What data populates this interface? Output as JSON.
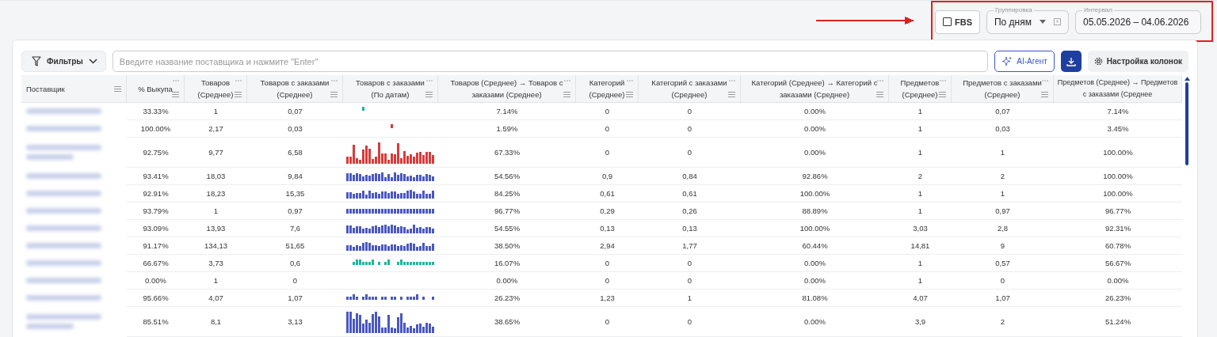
{
  "header": {
    "fbs": {
      "label": "FBS",
      "checked": false
    },
    "grouping": {
      "legend": "Группировка",
      "value": "По дням"
    },
    "interval": {
      "legend": "Интервал",
      "value": "05.05.2026 – 04.06.2026"
    }
  },
  "annotation": {
    "kind": "arrow-box",
    "color": "#e02020"
  },
  "toolbar": {
    "filters": "Фильтры",
    "search": {
      "placeholder": "Введите название поставщика и нажмите \"Enter\""
    },
    "ai": "AI-Агент",
    "settings": "Настройка колонок"
  },
  "table": {
    "columns": [
      {
        "label": "Поставщик",
        "kind": "name"
      },
      {
        "label": "% Выкупа",
        "kind": "num"
      },
      {
        "label": "Товаров (Среднее)",
        "kind": "num"
      },
      {
        "label": "Товаров с заказами (Среднее)",
        "kind": "num"
      },
      {
        "label": "Товаров с заказами (По датам)",
        "kind": "spark"
      },
      {
        "label": "Товаров (Среднее) → Товаров с заказами (Среднее)",
        "kind": "num"
      },
      {
        "label": "Категорий (Среднее)",
        "kind": "num"
      },
      {
        "label": "Категорий с заказами (Среднее)",
        "kind": "num"
      },
      {
        "label": "Категорий (Среднее) → Категорий с заказами (Среднее)",
        "kind": "num"
      },
      {
        "label": "Предметов (Среднее)",
        "kind": "num"
      },
      {
        "label": "Предметов с заказами (Среднее)",
        "kind": "num"
      },
      {
        "label": "Предметов (Среднее) → Предметов с заказами (Среднее",
        "kind": "num"
      }
    ],
    "rows": [
      {
        "kind": "single",
        "sparkline": {
          "kind": "single",
          "color": "#1fb59f"
        },
        "cells": [
          "",
          "33.33%",
          "1",
          "0,07",
          "",
          "7.14%",
          "0",
          "0",
          "0.00%",
          "1",
          "0,07",
          "7.14%"
        ]
      },
      {
        "kind": "single",
        "sparkline": {
          "kind": "single",
          "color": "#d93a3a"
        },
        "cells": [
          "",
          "100.00%",
          "2,17",
          "0,03",
          "",
          "1.59%",
          "0",
          "0",
          "0.00%",
          "1",
          "0,03",
          "3.45%"
        ]
      },
      {
        "kind": "double",
        "sparkline": {
          "kind": "tall",
          "color": "#d93a3a"
        },
        "cells": [
          "",
          "92.75%",
          "9,77",
          "6,58",
          "",
          "67.33%",
          "0",
          "0",
          "0.00%",
          "1",
          "1",
          "100.00%"
        ]
      },
      {
        "kind": "single",
        "sparkline": {
          "kind": "flat",
          "color": "#4a58c0"
        },
        "cells": [
          "",
          "93.41%",
          "18,03",
          "9,84",
          "",
          "54.56%",
          "0,9",
          "0,84",
          "92.86%",
          "2",
          "2",
          "100.00%"
        ]
      },
      {
        "kind": "single",
        "sparkline": {
          "kind": "flat",
          "color": "#4a58c0"
        },
        "cells": [
          "",
          "92.91%",
          "18,23",
          "15,35",
          "",
          "84.25%",
          "0,61",
          "0,61",
          "100.00%",
          "1",
          "1",
          "100.00%"
        ]
      },
      {
        "kind": "single",
        "sparkline": {
          "kind": "even",
          "color": "#4a58c0"
        },
        "cells": [
          "",
          "93.79%",
          "1",
          "0,97",
          "",
          "96.77%",
          "0,29",
          "0,26",
          "88.89%",
          "1",
          "0,97",
          "96.77%"
        ]
      },
      {
        "kind": "single",
        "sparkline": {
          "kind": "flat",
          "color": "#4a58c0"
        },
        "cells": [
          "",
          "93.09%",
          "13,93",
          "7,6",
          "",
          "54.55%",
          "0,13",
          "0,13",
          "100.00%",
          "3,03",
          "2,8",
          "92.31%"
        ]
      },
      {
        "kind": "single",
        "sparkline": {
          "kind": "flat",
          "color": "#4a58c0"
        },
        "cells": [
          "",
          "91.17%",
          "134,13",
          "51,65",
          "",
          "38.50%",
          "2,94",
          "1,77",
          "60.44%",
          "14,81",
          "9",
          "60.78%"
        ]
      },
      {
        "kind": "single",
        "sparkline": {
          "kind": "dots",
          "color": "#1fb59f"
        },
        "cells": [
          "",
          "66.67%",
          "3,73",
          "0,6",
          "",
          "16.07%",
          "0",
          "0",
          "0.00%",
          "1",
          "0,57",
          "56.67%"
        ]
      },
      {
        "kind": "single",
        "cells": [
          "",
          "0.00%",
          "1",
          "0",
          "",
          "0.00%",
          "0",
          "0",
          "0.00%",
          "1",
          "0",
          "0.00%"
        ]
      },
      {
        "kind": "single",
        "sparkline": {
          "kind": "dots",
          "color": "#4a58c0"
        },
        "cells": [
          "",
          "95.66%",
          "4,07",
          "1,07",
          "",
          "26.23%",
          "1,23",
          "1",
          "81.08%",
          "4,07",
          "1,07",
          "26.23%"
        ]
      },
      {
        "kind": "double",
        "sparkline": {
          "kind": "tall",
          "color": "#4a58c0"
        },
        "cells": [
          "",
          "85.51%",
          "8,1",
          "3,13",
          "",
          "38.65%",
          "0",
          "0",
          "0.00%",
          "3,9",
          "2",
          "51.24%"
        ]
      }
    ]
  }
}
